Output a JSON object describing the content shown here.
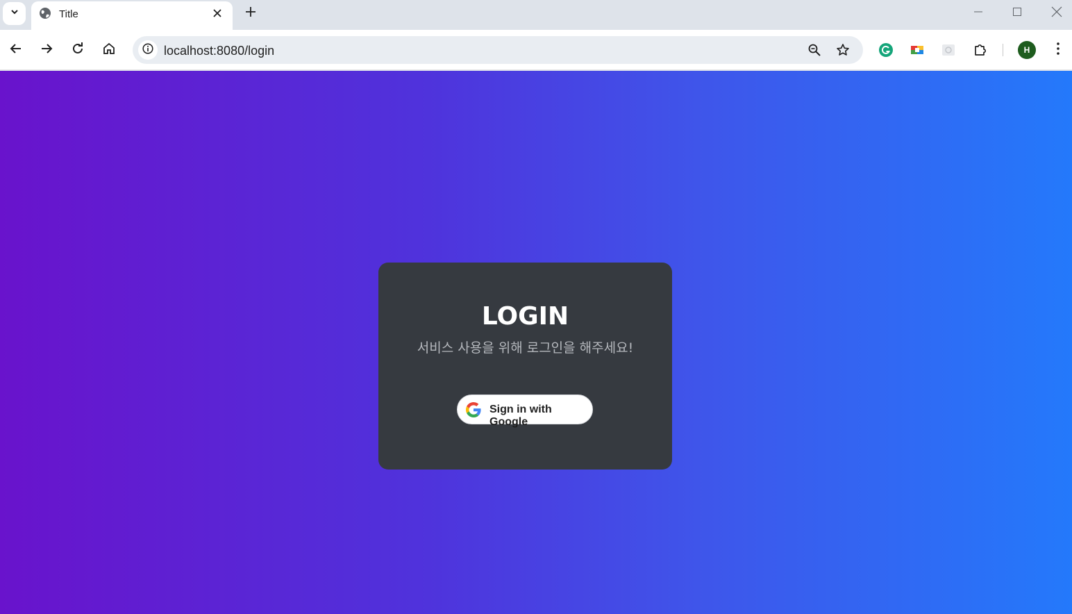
{
  "browser": {
    "tab": {
      "title": "Title"
    },
    "address_bar": {
      "url": "localhost:8080/login"
    },
    "profile": {
      "initial": "H"
    }
  },
  "page": {
    "card": {
      "title": "LOGIN",
      "subtitle": "서비스 사용을 위해 로그인을 해주세요!",
      "google_button_label": "Sign in with Google"
    }
  },
  "colors": {
    "gradient_start": "#6913cc",
    "gradient_end": "#2479fb",
    "card_background": "#363a40",
    "profile_avatar": "#1e5c1e"
  }
}
